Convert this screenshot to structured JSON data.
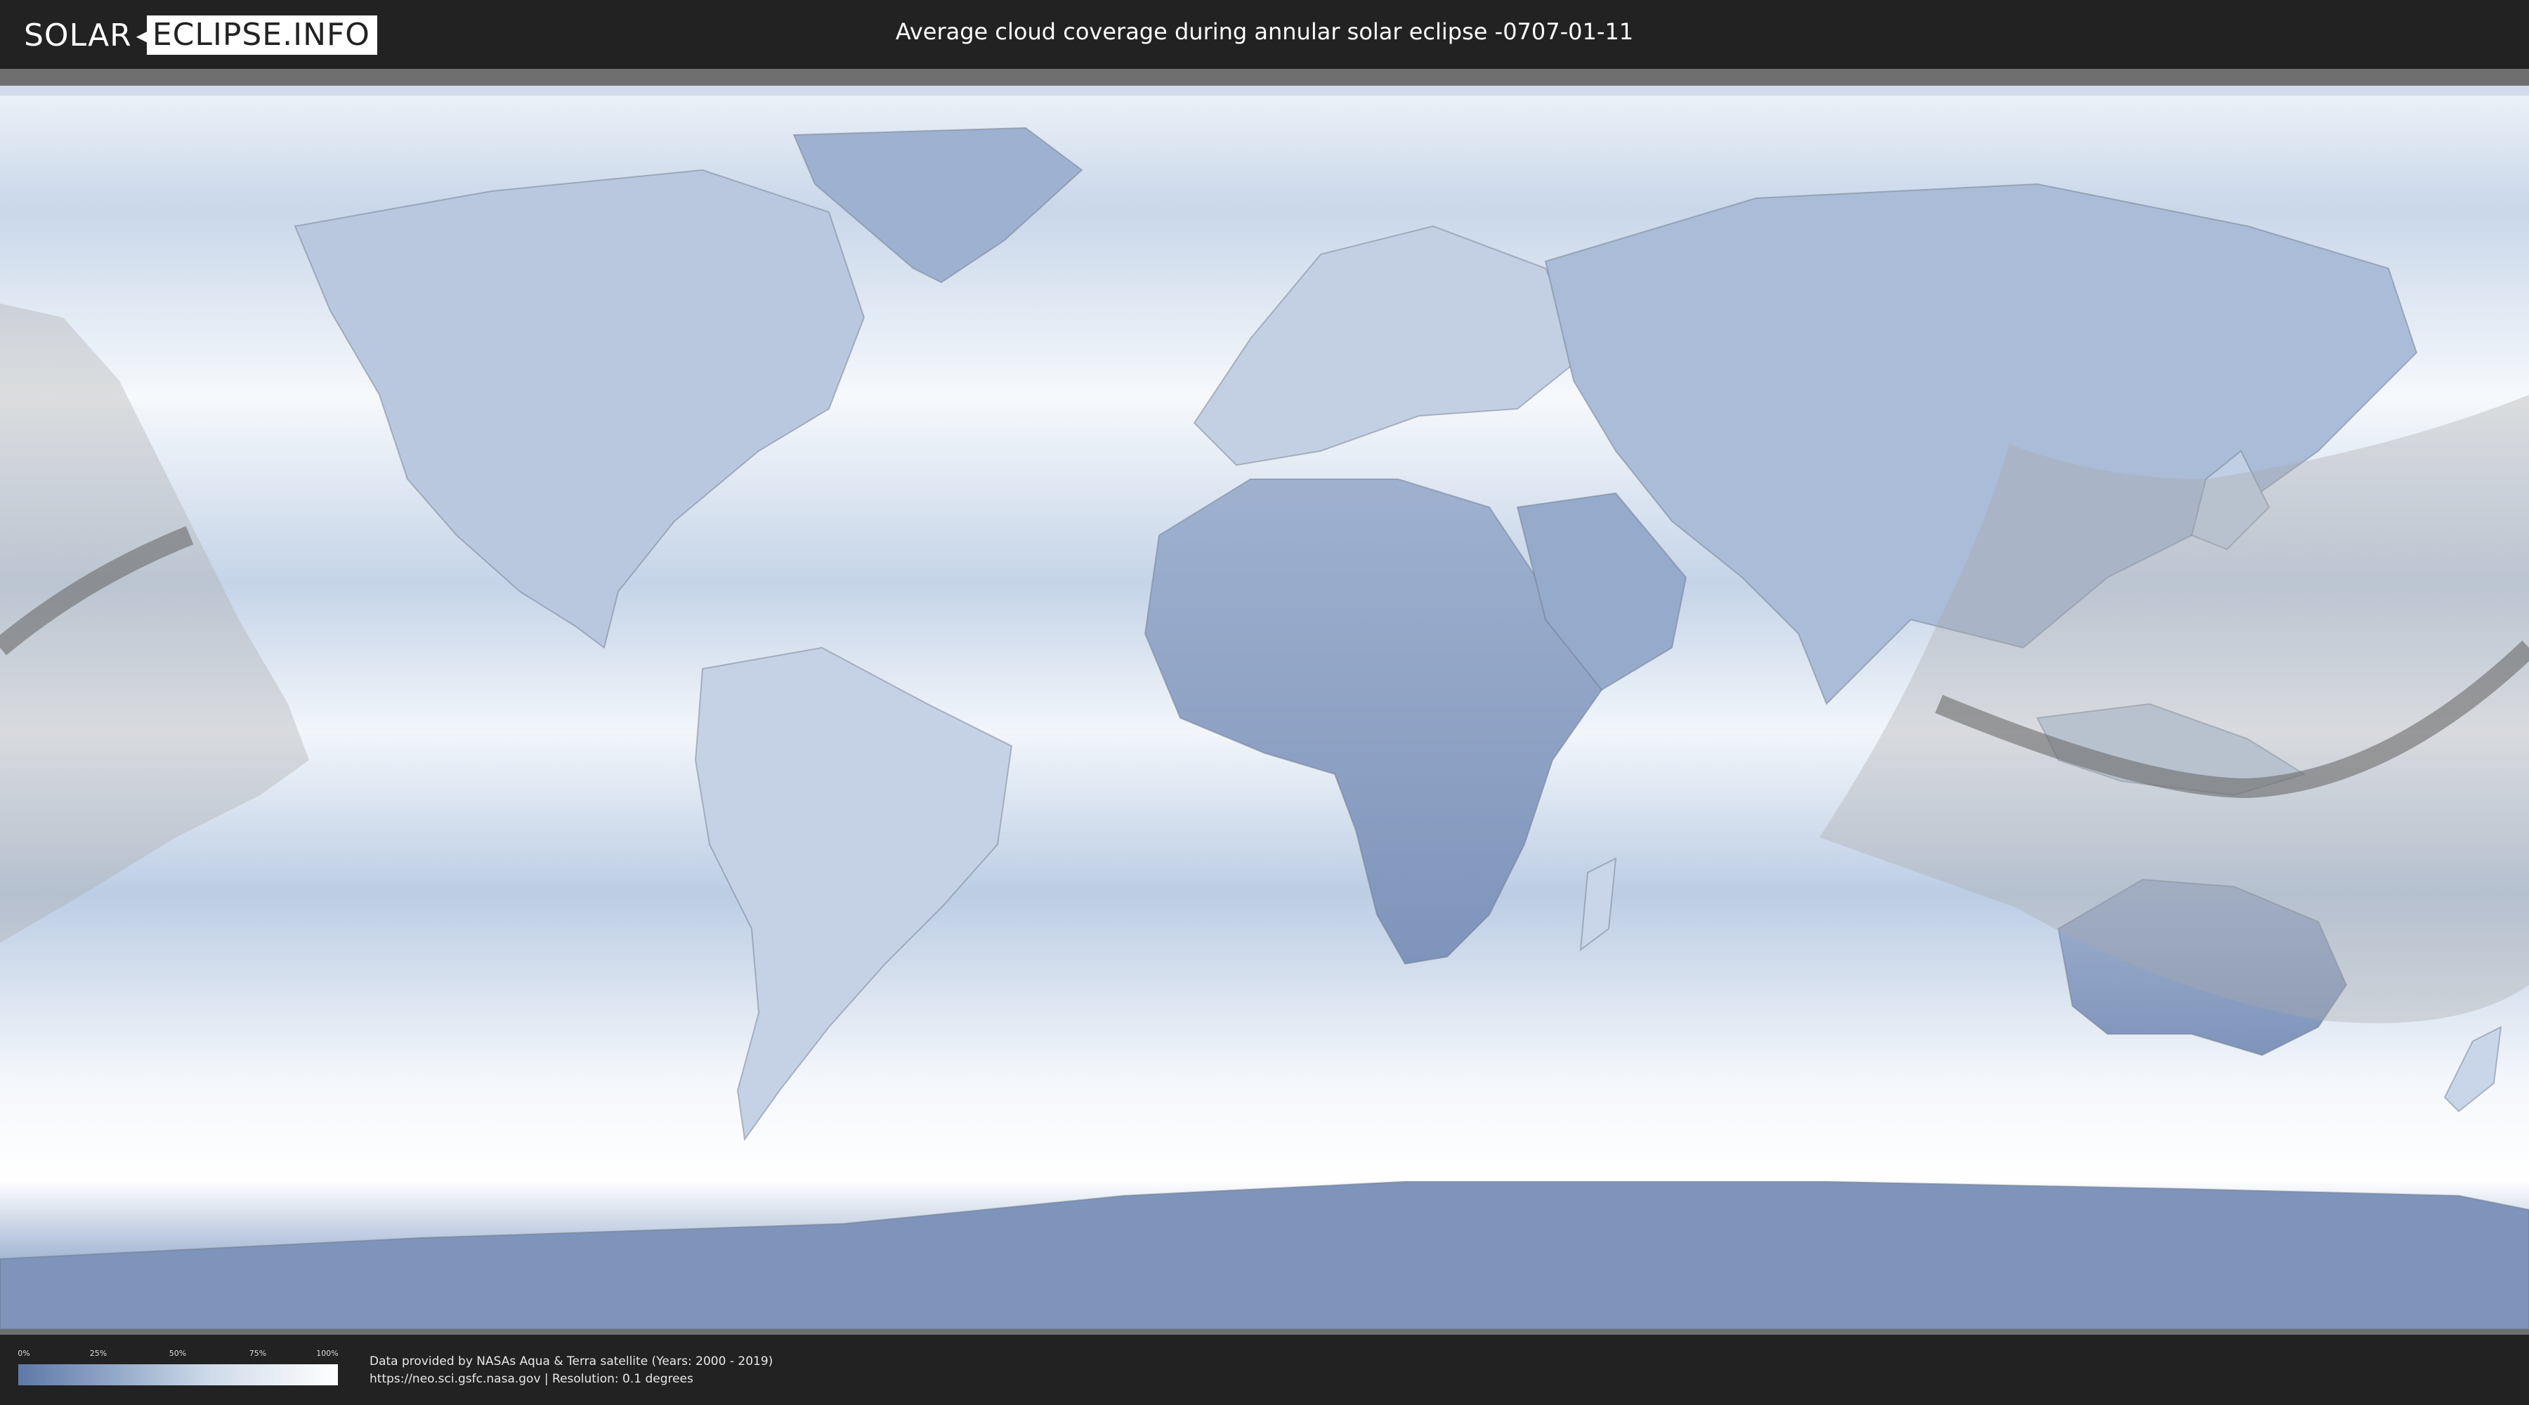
{
  "header": {
    "logo": {
      "left": "SOLAR",
      "right": "ECLIPSE.INFO"
    },
    "title": "Average cloud coverage during annular solar eclipse -0707-01-11"
  },
  "map": {
    "type": "cloud-coverage-world-map",
    "projection": "equirectangular",
    "overlays": [
      "eclipse-visibility-zone",
      "annularity-path"
    ],
    "colors": {
      "clear": "#5f79a8",
      "cloudy": "#ffffff",
      "zone": "#a8a8a8",
      "path": "#6a6a6a",
      "border": "#6b7584"
    }
  },
  "legend": {
    "ticks": [
      "0%",
      "25%",
      "50%",
      "75%",
      "100%"
    ],
    "values": [
      0,
      25,
      50,
      75,
      100
    ],
    "gradient": [
      "#5f79a8",
      "#8fa5c6",
      "#cfdbea",
      "#ffffff"
    ]
  },
  "footer": {
    "credit_line1": "Data provided by NASAs Aqua & Terra satellite (Years: 2000 - 2019)",
    "credit_line2": "https://neo.sci.gsfc.nasa.gov | Resolution: 0.1 degrees"
  }
}
